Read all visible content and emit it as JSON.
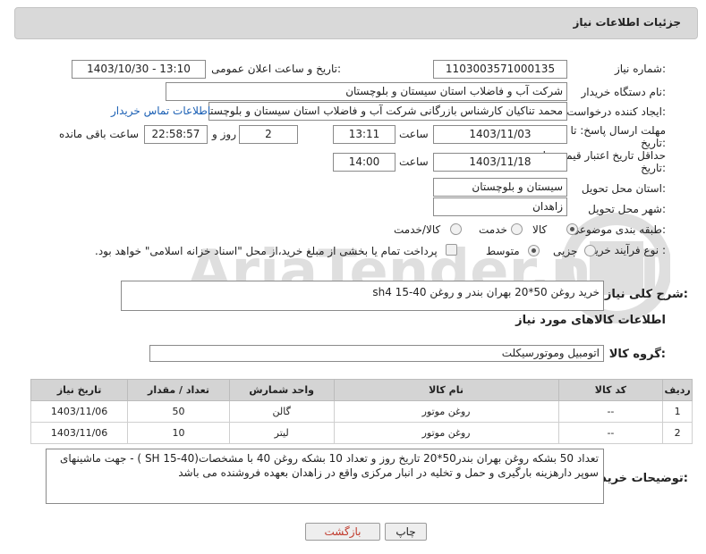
{
  "header": {
    "title": "جزئیات اطلاعات نیاز"
  },
  "fields": {
    "need_number_label": "شماره نیاز:",
    "need_number": "1103003571000135",
    "announce_label": "تاریخ و ساعت اعلان عمومی:",
    "announce_value": "1403/10/30 - 13:10",
    "buyer_org_label": "نام دستگاه خریدار:",
    "buyer_org": "شرکت آب و فاضلاب استان سیستان و بلوچستان",
    "creator_label": "ایجاد کننده درخواست:",
    "creator": "محمد تناکیان کارشناس بازرگانی شرکت آب و فاضلاب استان سیستان و بلوچستان",
    "contact_link": "اطلاعات تماس خریدار",
    "deadline_label_1": "مهلت ارسال پاسخ: تا",
    "deadline_label_2": "تاریخ:",
    "deadline_date": "1403/11/03",
    "time_label": "ساعت",
    "deadline_time": "13:11",
    "days_value": "2",
    "days_label": "روز و",
    "remaining_value": "22:58:57",
    "remaining_label": "ساعت باقی مانده",
    "validity_label_1": "حداقل تاریخ اعتبار قیمت: تا",
    "validity_label_2": "تاریخ:",
    "validity_date": "1403/11/18",
    "validity_time_label": "ساعت",
    "validity_time": "14:00",
    "province_label": "استان محل تحویل:",
    "province": "سیستان و بلوچستان",
    "city_label": "شهر محل تحویل:",
    "city": "زاهدان",
    "category_label": "طبقه بندی موضوعی:",
    "category_options": [
      "کالا",
      "خدمت",
      "کالا/خدمت"
    ],
    "process_label": "نوع فرآیند خرید :",
    "process_options": [
      "جزیی",
      "متوسط"
    ],
    "payment_note": "پرداخت تمام یا بخشی از مبلغ خرید،از محل \"اسناد خزانه اسلامی\" خواهد بود."
  },
  "description": {
    "label": "شرح کلی نیاز:",
    "value": "خرید روغن 50*20 بهران بندر و روغن sh4 15-40"
  },
  "goods": {
    "section_title": "اطلاعات کالاهای مورد نیاز",
    "group_label": "گروه کالا:",
    "group_value": "اتومبیل وموتورسیکلت",
    "columns": [
      "ردیف",
      "کد کالا",
      "نام کالا",
      "واحد شمارش",
      "تعداد / مقدار",
      "تاریخ نیاز"
    ],
    "rows": [
      [
        "1",
        "--",
        "روغن موتور",
        "گالن",
        "50",
        "1403/11/06"
      ],
      [
        "2",
        "--",
        "روغن موتور",
        "لیتر",
        "10",
        "1403/11/06"
      ]
    ]
  },
  "buyer_notes": {
    "label": "توضیحات خریدار:",
    "value": "تعداد 50 بشکه روغن بهران بندر50*20 تاریخ روز و تعداد 10 بشکه روغن 40 با مشخصات(SH 15-40 ) - جهت ماشینهای سوپر دارهزینه بارگیری و حمل و تخلیه در انبار مرکزی واقع در زاهدان بعهده فروشنده می باشد"
  },
  "buttons": {
    "print": "چاپ",
    "back": "بازگشت"
  },
  "watermark": {
    "text": "AriaTender.neT"
  }
}
